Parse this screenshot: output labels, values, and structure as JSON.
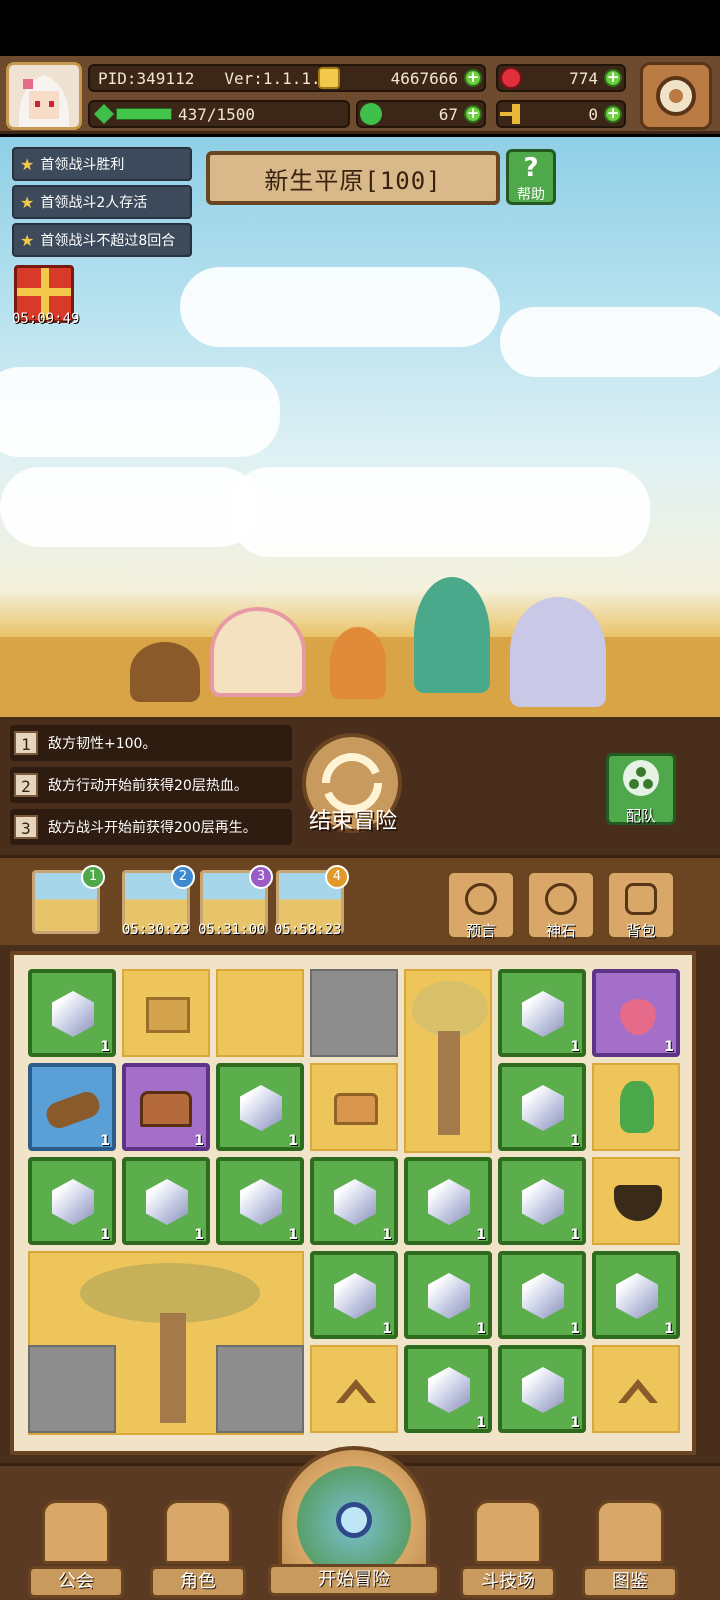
{
  "hud": {
    "pid": "PID:349112",
    "version": "Ver:1.1.1.3",
    "gold": "4667666",
    "gems": "774",
    "energy": "437/1500",
    "clover": "67",
    "keys": "0"
  },
  "quests": [
    {
      "label": "首领战斗胜利"
    },
    {
      "label": "首领战斗2人存活"
    },
    {
      "label": "首领战斗不超过8回合"
    }
  ],
  "gift": {
    "timer": "05:09:49"
  },
  "stage": {
    "title": "新生平原[100]",
    "help_label": "帮助"
  },
  "effects": [
    {
      "num": "1",
      "text": "敌方韧性+100。"
    },
    {
      "num": "2",
      "text": "敌方行动开始前获得20层热血。"
    },
    {
      "num": "3",
      "text": "敌方战斗开始前获得200层再生。"
    }
  ],
  "end_adventure_label": "结束冒险",
  "team_label": "配队",
  "slots": [
    {
      "badge": "1",
      "timer": ""
    },
    {
      "badge": "2",
      "timer": "05:30:23"
    },
    {
      "badge": "3",
      "timer": "05:31:00"
    },
    {
      "badge": "4",
      "timer": "05:58:23"
    }
  ],
  "tools": [
    {
      "label": "预言",
      "icon": "crystal-ball-icon"
    },
    {
      "label": "神石",
      "icon": "stone-icon"
    },
    {
      "label": "背包",
      "icon": "backpack-icon"
    }
  ],
  "grid_count": "1",
  "nav": [
    {
      "label": "公会",
      "icon": "guild-house-icon"
    },
    {
      "label": "角色",
      "icon": "character-icon"
    },
    {
      "label": "开始冒险",
      "icon": "magnifier-globe-icon"
    },
    {
      "label": "斗技场",
      "icon": "crossed-swords-icon"
    },
    {
      "label": "图鉴",
      "icon": "book-icon"
    }
  ],
  "colors": {
    "wood": "#6b4522",
    "green_tile": "#5cae4c",
    "yellow_tile": "#edc55a",
    "purple_tile": "#a36fc9",
    "blue_tile": "#5a9fd6"
  }
}
